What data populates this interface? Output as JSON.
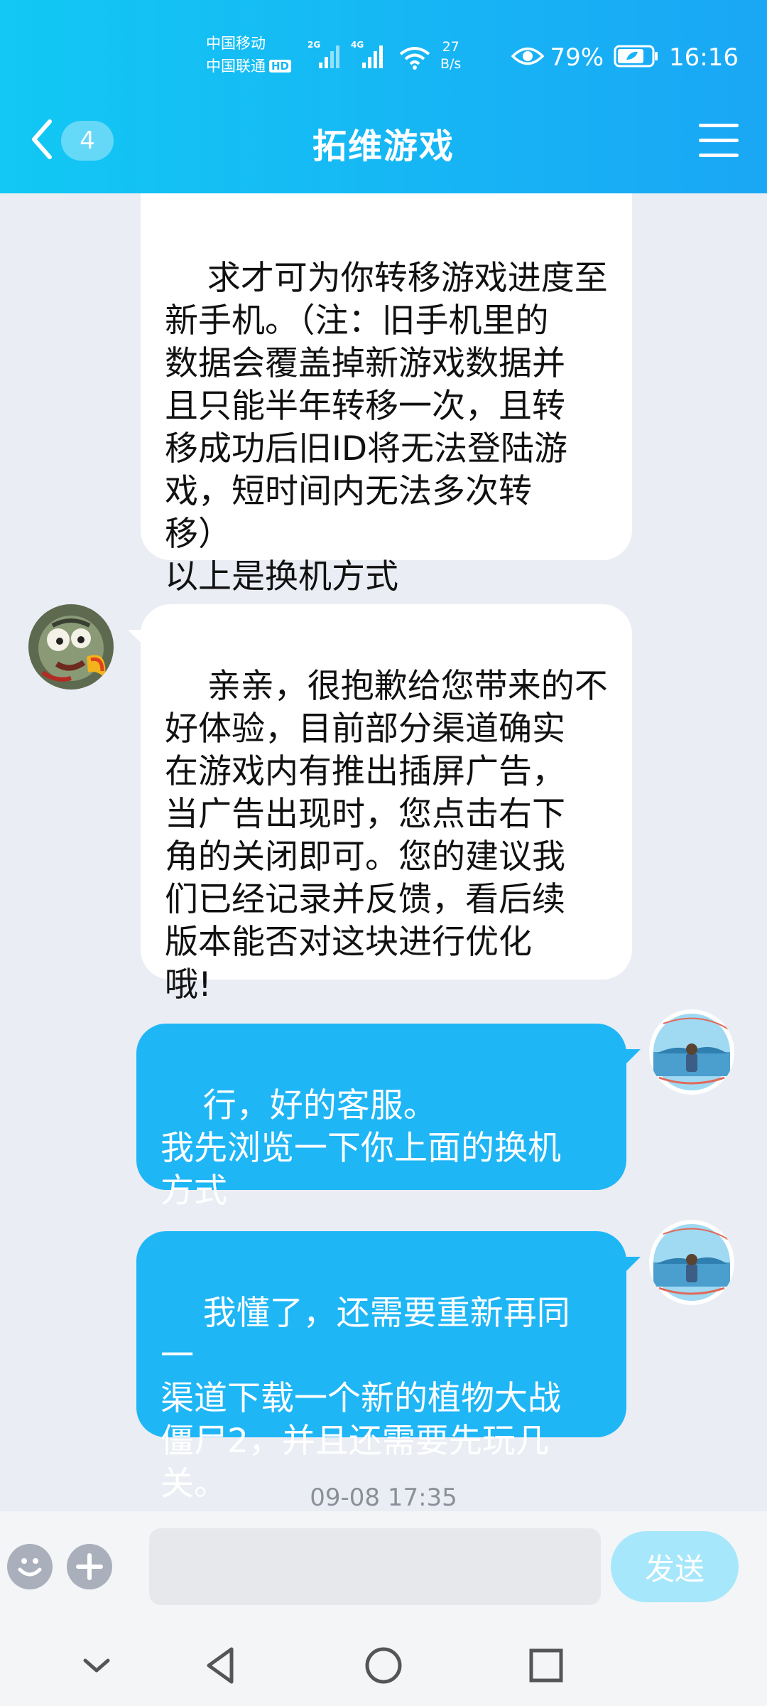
{
  "status_bar": {
    "carrier_1": "中国移动",
    "carrier_2": "中国联通",
    "hd_label": "HD",
    "signal_1_label": "2G",
    "signal_2_label": "4G",
    "net_speed_value": "27",
    "net_speed_unit": "B/s",
    "battery": "79%",
    "time": "16:16"
  },
  "header": {
    "unread_count": "4",
    "title": "拓维游戏"
  },
  "messages": [
    {
      "side": "incoming",
      "text": "求才可为你转移游戏进度至\n新手机。（注：旧手机里的\n数据会覆盖掉新游戏数据并\n且只能半年转移一次，且转\n移成功后旧ID将无法登陆游\n戏，短时间内无法多次转\n移）\n以上是换机方式"
    },
    {
      "side": "incoming",
      "text": "亲亲，很抱歉给您带来的不\n好体验，目前部分渠道确实\n在游戏内有推出插屏广告，\n当广告出现时，您点击右下\n角的关闭即可。您的建议我\n们已经记录并反馈，看后续\n版本能否对这块进行优化\n哦!"
    },
    {
      "side": "outgoing",
      "text": "行，好的客服。\n我先浏览一下你上面的换机\n方式"
    },
    {
      "side": "outgoing",
      "text": "我懂了，还需要重新再同一\n渠道下载一个新的植物大战\n僵尸2，并且还需要先玩几\n关。"
    }
  ],
  "timestamp": "09-08 17:35",
  "input": {
    "value": "",
    "placeholder": ""
  },
  "send_label": "发送",
  "colors": {
    "header_start": "#12c8f4",
    "header_end": "#1aa7f5",
    "outgoing_bubble": "#1fb6f6",
    "incoming_bubble": "#ffffff",
    "chat_background": "#eaedf3",
    "send_button": "#a7e7fb"
  }
}
